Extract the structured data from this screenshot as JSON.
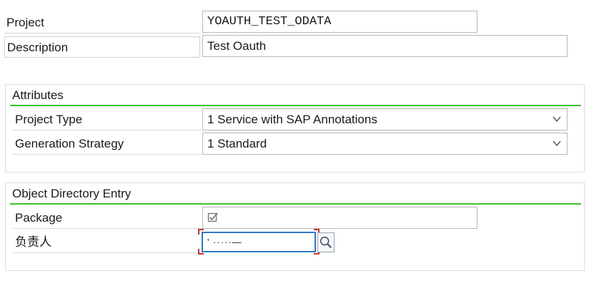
{
  "header": {
    "project_label": "Project",
    "project_value": "YOAUTH_TEST_ODATA",
    "description_label": "Description",
    "description_value": "Test Oauth"
  },
  "attributes": {
    "title": "Attributes",
    "project_type_label": "Project Type",
    "project_type_value": "1 Service with SAP Annotations",
    "generation_strategy_label": "Generation Strategy",
    "generation_strategy_value": "1 Standard"
  },
  "object_directory": {
    "title": "Object Directory Entry",
    "package_label": "Package",
    "package_value": "",
    "responsible_label": "负责人",
    "responsible_value": "'  ·····—"
  },
  "colors": {
    "accent_rule": "#3cc22a",
    "focus_border": "#2f79c9",
    "required_marker": "#c0392b"
  },
  "icons": {
    "dropdown": "chevron-down-icon",
    "package_check": "checkbox-check-icon",
    "value_help": "search-magnifier-icon"
  }
}
